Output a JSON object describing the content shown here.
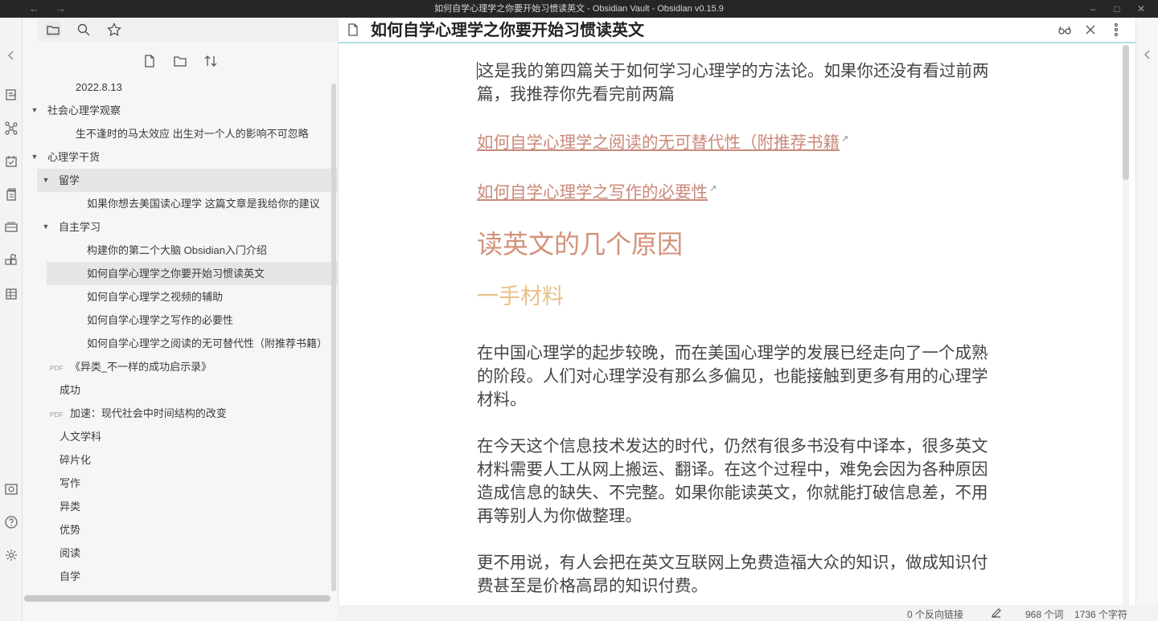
{
  "window": {
    "title": "如何自学心理学之你要开始习惯读英文 - Obsidian Vault - Obsidian v0.15.9",
    "back": "←",
    "forward": "→",
    "minimize": "–",
    "maximize": "□",
    "close": "✕"
  },
  "sidebar": {
    "tree": [
      {
        "label": "2022.8.13",
        "depth": 2,
        "type": "file"
      },
      {
        "label": "社会心理学观察",
        "depth": 0,
        "type": "folder",
        "arrow": "▼"
      },
      {
        "label": "生不逢时的马太效应 出生对一个人的影响不可忽略",
        "depth": 2,
        "type": "file"
      },
      {
        "label": "心理学干货",
        "depth": 0,
        "type": "folder",
        "arrow": "▼"
      },
      {
        "label": "留学",
        "depth": 1,
        "type": "folder",
        "arrow": "▼",
        "hover": true
      },
      {
        "label": "如果你想去美国读心理学 这篇文章是我给你的建议",
        "depth": 3,
        "type": "file"
      },
      {
        "label": "自主学习",
        "depth": 1,
        "type": "folder",
        "arrow": "▼"
      },
      {
        "label": "构建你的第二个大脑 Obsidian入门介绍",
        "depth": 3,
        "type": "file"
      },
      {
        "label": "如何自学心理学之你要开始习惯读英文",
        "depth": 3,
        "type": "file",
        "selected": true
      },
      {
        "label": "如何自学心理学之视频的辅助",
        "depth": 3,
        "type": "file"
      },
      {
        "label": "如何自学心理学之写作的必要性",
        "depth": 3,
        "type": "file"
      },
      {
        "label": "如何自学心理学之阅读的无可替代性（附推荐书籍）",
        "depth": 3,
        "type": "file"
      },
      {
        "label": "《异类_不一样的成功启示录》",
        "depth": 1,
        "type": "pdf",
        "badge": "PDF"
      },
      {
        "label": "成功",
        "depth": 1,
        "type": "file"
      },
      {
        "label": "加速：现代社会中时间结构的改变",
        "depth": 1,
        "type": "pdf",
        "badge": "PDF"
      },
      {
        "label": "人文学科",
        "depth": 1,
        "type": "file"
      },
      {
        "label": "碎片化",
        "depth": 1,
        "type": "file"
      },
      {
        "label": "写作",
        "depth": 1,
        "type": "file"
      },
      {
        "label": "异类",
        "depth": 1,
        "type": "file"
      },
      {
        "label": "优势",
        "depth": 1,
        "type": "file"
      },
      {
        "label": "阅读",
        "depth": 1,
        "type": "file"
      },
      {
        "label": "自学",
        "depth": 1,
        "type": "file"
      }
    ]
  },
  "note": {
    "title": "如何自学心理学之你要开始习惯读英文",
    "intro": "这是我的第四篇关于如何学习心理学的方法论。如果你还没有看过前两篇，我推荐你先看完前两篇",
    "link1": "如何自学心理学之阅读的无可替代性（附推荐书籍",
    "link2": "如何自学心理学之写作的必要性",
    "h2": "读英文的几个原因",
    "h3": "一手材料",
    "p1": "在中国心理学的起步较晚，而在美国心理学的发展已经走向了一个成熟的阶段。人们对心理学没有那么多偏见，也能接触到更多有用的心理学材料。",
    "p2": "在今天这个信息技术发达的时代，仍然有很多书没有中译本，很多英文材料需要人工从网上搬运、翻译。在这个过程中，难免会因为各种原因造成信息的缺失、不完整。如果你能读英文，你就能打破信息差，不用再等别人为你做整理。",
    "p3": "更不用说，有人会把在英文互联网上免费造福大众的知识，做成知识付费甚至是价格高昂的知识付费。",
    "ext_icon": "↗"
  },
  "status": {
    "backlinks": "0 个反向链接",
    "words": "968 个词",
    "chars": "1736 个字符"
  },
  "colors": {
    "h2": "#d29279",
    "h3": "#e8c186",
    "link": "#c9897a",
    "accent_border": "#b0dfe5"
  }
}
